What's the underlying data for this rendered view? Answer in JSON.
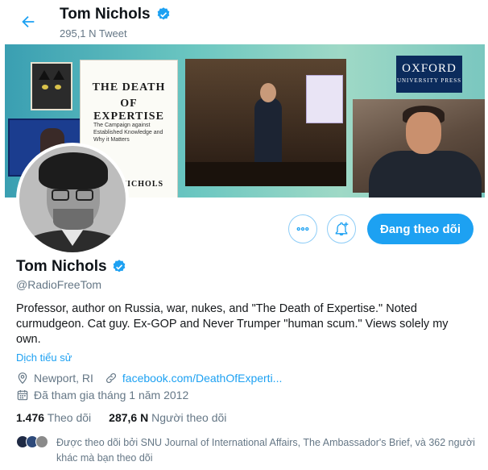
{
  "header": {
    "name": "Tom Nichols",
    "tweet_count": "295,1 N Tweet"
  },
  "banner": {
    "book_title_line1": "THE DEATH",
    "book_title_line2": "OF EXPERTISE",
    "book_subtitle": "The Campaign against Established Knowledge and Why it Matters",
    "book_author": "M NICHOLS",
    "publisher_line1": "OXFORD",
    "publisher_line2": "UNIVERSITY PRESS"
  },
  "actions": {
    "follow_label": "Đang theo dõi"
  },
  "profile": {
    "name": "Tom Nichols",
    "handle": "@RadioFreeTom",
    "bio": "Professor, author on Russia, war, nukes, and \"The Death of Expertise.\" Noted curmudgeon.  Cat guy. Ex-GOP and Never Trumper \"human scum.\" Views solely my own.",
    "translate_label": "Dịch tiểu sử",
    "location": "Newport, RI",
    "website": "facebook.com/DeathOfExperti...",
    "joined": "Đã tham gia tháng 1 năm 2012"
  },
  "stats": {
    "following_count": "1.476",
    "following_label": "Theo dõi",
    "followers_count": "287,6 N",
    "followers_label": "Người theo dõi"
  },
  "followed_by": {
    "text": "Được theo dõi bởi SNU Journal of International Affairs, The Ambassador's Brief, và 362 người khác mà bạn theo dõi"
  },
  "colors": {
    "accent": "#1da1f2",
    "secondary_text": "#657786"
  }
}
